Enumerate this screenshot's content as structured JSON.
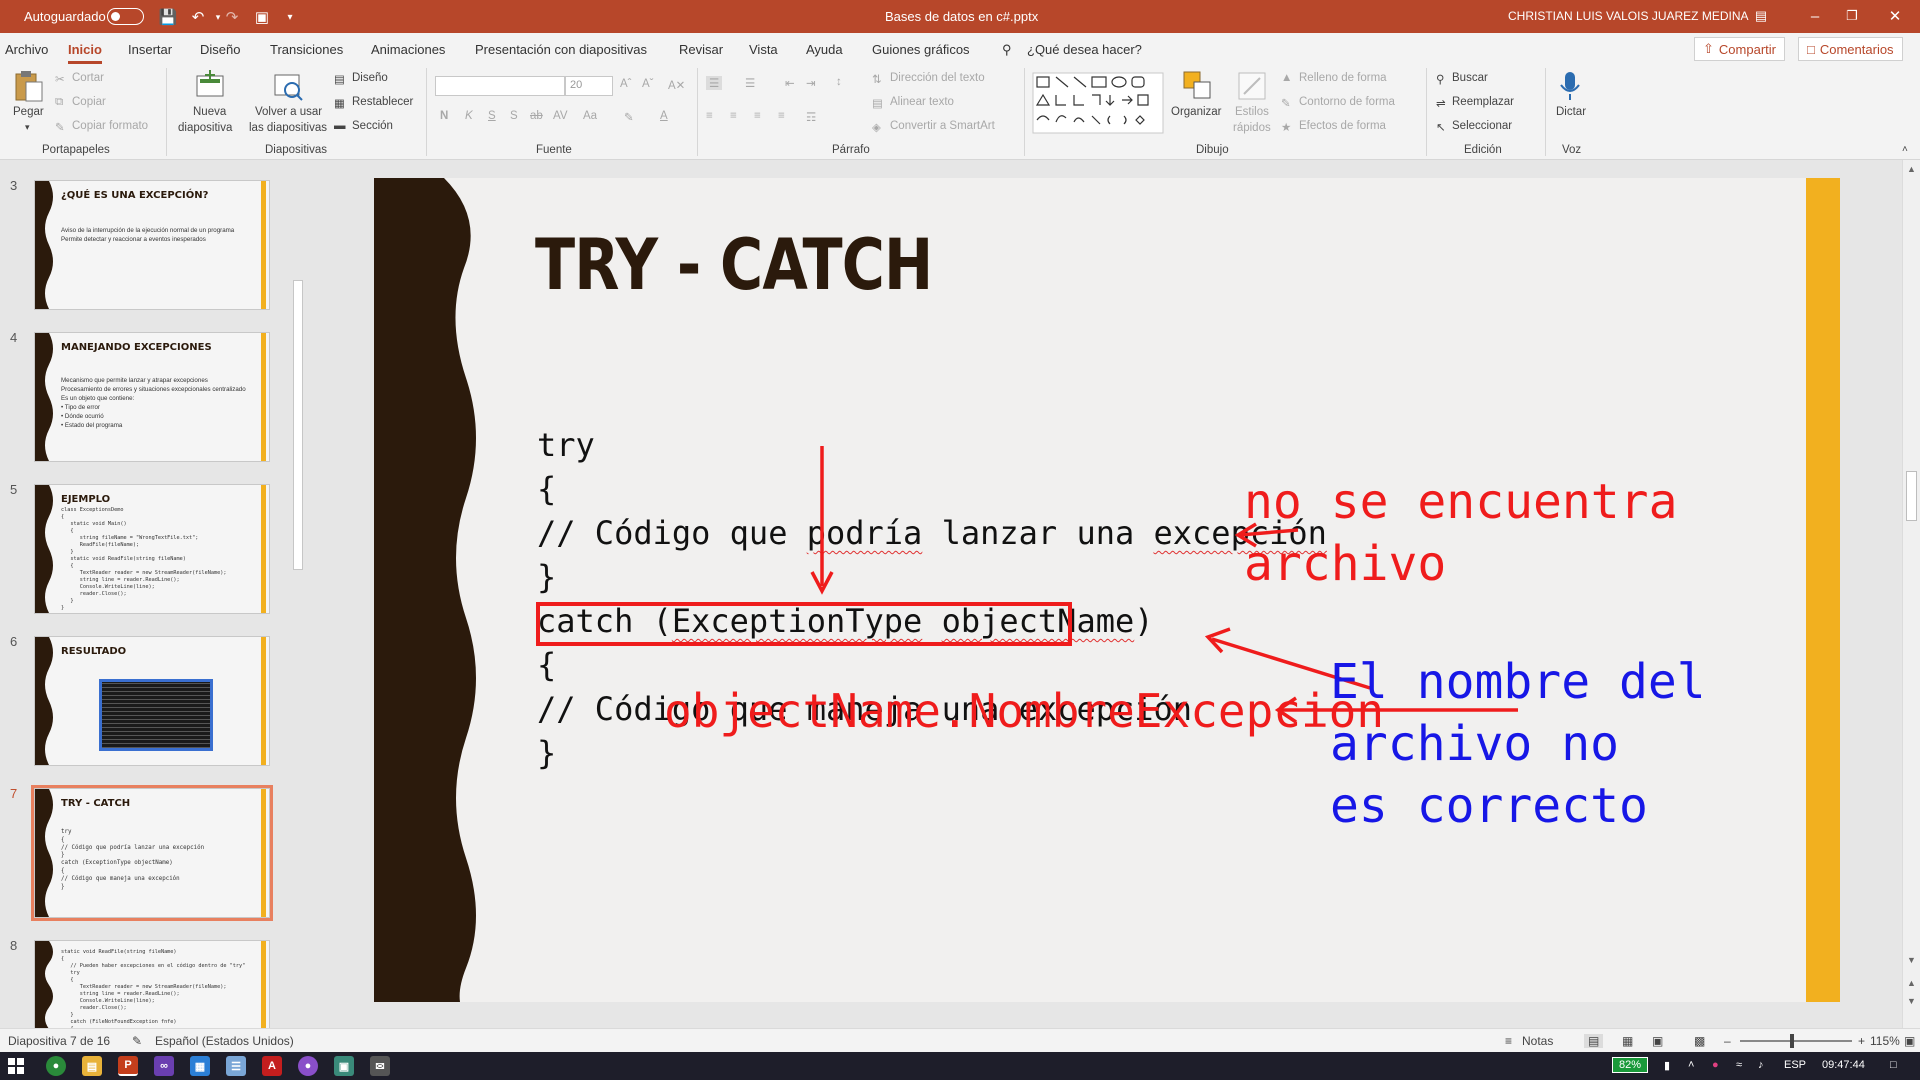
{
  "titlebar": {
    "autosave_label": "Autoguardado",
    "file_name": "Bases de datos en c#.pptx",
    "user_name": "CHRISTIAN LUIS VALOIS JUAREZ MEDINA"
  },
  "menu": {
    "tabs": [
      "Archivo",
      "Inicio",
      "Insertar",
      "Diseño",
      "Transiciones",
      "Animaciones",
      "Presentación con diapositivas",
      "Revisar",
      "Vista",
      "Ayuda",
      "Guiones gráficos"
    ],
    "active_tab": "Inicio",
    "search_placeholder": "¿Qué desea hacer?",
    "share_label": "Compartir",
    "comments_label": "Comentarios"
  },
  "ribbon": {
    "clipboard": {
      "paste": "Pegar",
      "cut": "Cortar",
      "copy": "Copiar",
      "format_painter": "Copiar formato",
      "group": "Portapapeles"
    },
    "slides": {
      "new_slide": "Nueva",
      "new_slide_2": "diapositiva",
      "reuse": "Volver a usar",
      "reuse_2": "las diapositivas",
      "layout": "Diseño",
      "reset": "Restablecer",
      "section": "Sección",
      "group": "Diapositivas"
    },
    "font": {
      "size": "20",
      "bold": "N",
      "italic": "K",
      "underline": "S",
      "shadow": "S",
      "strike": "ab",
      "spacing": "AV",
      "case": "Aa",
      "group": "Fuente"
    },
    "paragraph": {
      "text_direction": "Dirección del texto",
      "align_text": "Alinear texto",
      "smartart": "Convertir a SmartArt",
      "group": "Párrafo"
    },
    "drawing": {
      "arrange": "Organizar",
      "quick_styles": "Estilos",
      "quick_styles_2": "rápidos",
      "fill": "Relleno de forma",
      "outline": "Contorno de forma",
      "effects": "Efectos de forma",
      "group": "Dibujo"
    },
    "editing": {
      "find": "Buscar",
      "replace": "Reemplazar",
      "select": "Seleccionar",
      "group": "Edición"
    },
    "voice": {
      "dictate": "Dictar",
      "group": "Voz"
    }
  },
  "thumbnails": [
    {
      "num": "3",
      "title": "¿QUÉ ES UNA EXCEPCIÓN?",
      "body": "Aviso de la interrupción de la ejecución normal de un programa\nPermite detectar y reaccionar a eventos inesperados"
    },
    {
      "num": "4",
      "title": "MANEJANDO EXCEPCIONES",
      "body": "Mecanismo que permite lanzar y atrapar excepciones\nProcesamiento de errores y situaciones excepcionales centralizado\nEs un objeto que contiene:\n• Tipo de error\n• Dónde ocurrió\n• Estado del programa"
    },
    {
      "num": "5",
      "title": "EJEMPLO",
      "body": "class ExceptionsDemo\n{\n   static void Main()\n   {\n      string fileName = \"WrongTextFile.txt\";\n      ReadFile(fileName);\n   }\n   static void ReadFile(string fileName)\n   {\n      TextReader reader = new StreamReader(fileName);\n      string line = reader.ReadLine();\n      Console.WriteLine(line);\n      reader.Close();\n   }\n}"
    },
    {
      "num": "6",
      "title": "RESULTADO",
      "body": ""
    },
    {
      "num": "7",
      "title": "TRY - CATCH",
      "body": "try\n{\n// Código que podría lanzar una excepción\n}\ncatch (ExceptionType objectName)\n{\n// Código que maneja una excepción\n}"
    },
    {
      "num": "8",
      "title": "",
      "body": "static void ReadFile(string fileName)\n{\n   // Pueden haber excepciones en el código dentro de \"try\"\n   try\n   {\n      TextReader reader = new StreamReader(fileName);\n      string line = reader.ReadLine();\n      Console.WriteLine(line);\n      reader.Close();\n   }\n   catch (FileNotFoundException fnfe)\n   {\n      // Manejo de excepción para FileNotFoundException\n      Console.WriteLine(\"The file '{0}' is not found.\", fileName);\n   }"
    }
  ],
  "slide": {
    "title": "TRY - CATCH",
    "code": {
      "l1": "try",
      "l2": "{",
      "l3a": "// Código que ",
      "l3b": "podría",
      "l3c": " lanzar una ",
      "l3d": "excepción",
      "l4": "}",
      "l5a": "catch (",
      "l5b": "ExceptionType",
      "l5c": " ",
      "l5d": "objectName",
      "l5e": ")",
      "l6": "{",
      "l7": "// Código que maneja una excepción",
      "l8": "}"
    },
    "annotations": {
      "red1": "no se encuentra",
      "red2": "archivo",
      "red3": "objectName.NombreExcepcion",
      "blue1": "El nombre del",
      "blue2": "archivo no",
      "blue3": "es correcto"
    },
    "colors": {
      "accent": "#f2b01f",
      "wave": "#2b1a0c",
      "annotation_red": "#ef1c1c",
      "annotation_blue": "#1717e6"
    }
  },
  "status": {
    "slide_info": "Diapositiva 7 de 16",
    "language": "Español (Estados Unidos)",
    "notes": "Notas",
    "zoom": "115%"
  },
  "taskbar": {
    "battery": "82%",
    "lang": "ESP",
    "time": "09:47:44"
  }
}
